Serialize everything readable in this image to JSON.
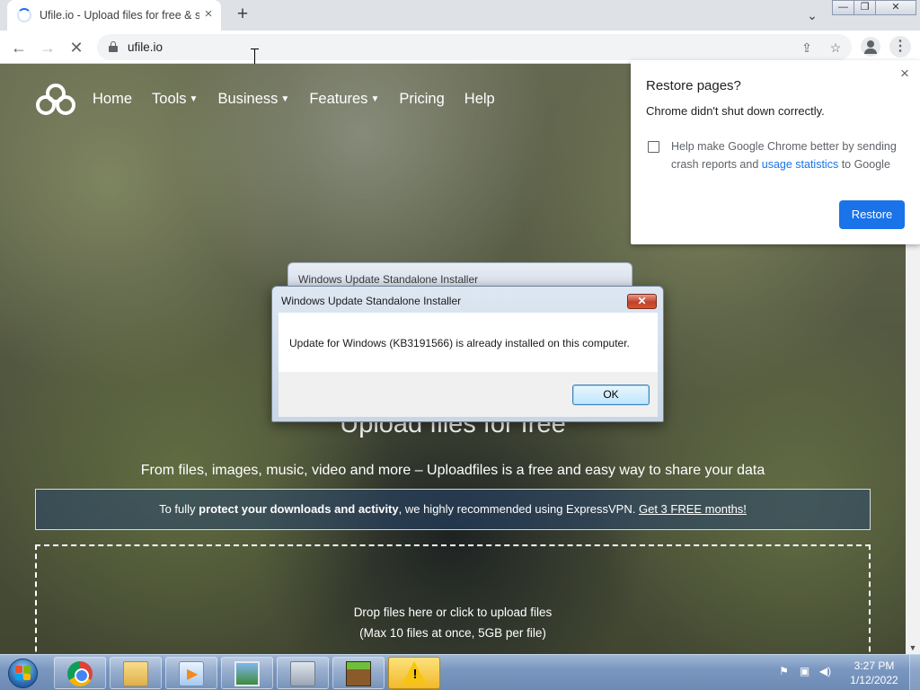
{
  "browser": {
    "tab_title": "Ufile.io - Upload files for free & s",
    "tab_close": "×",
    "new_tab": "+",
    "url": "ufile.io",
    "icons": [
      "back-arrow-icon",
      "forward-arrow-icon",
      "reload-stop-icon",
      "lock-icon",
      "share-icon",
      "bookmark-star-icon",
      "profile-icon",
      "kebab-menu-icon",
      "tab-search-icon"
    ],
    "window_buttons": {
      "minimize": "—",
      "restore": "❐",
      "close": "✕"
    }
  },
  "site": {
    "nav": [
      {
        "label": "Home",
        "dropdown": false
      },
      {
        "label": "Tools",
        "dropdown": true
      },
      {
        "label": "Business",
        "dropdown": true
      },
      {
        "label": "Features",
        "dropdown": true
      },
      {
        "label": "Pricing",
        "dropdown": false
      },
      {
        "label": "Help",
        "dropdown": false
      }
    ],
    "hero_title": "Upload files for free",
    "hero_subtitle": "From files, images, music, video and more – Uploadfiles is a free and easy way to share your data",
    "promo": {
      "prefix": "To fully ",
      "bold": "protect your downloads and activity",
      "middle": ", we highly recommended using ExpressVPN. ",
      "link": "Get 3 FREE months!"
    },
    "dropzone": {
      "line1": "Drop files here or click to upload files",
      "line2": "(Max 10 files at once, 5GB per file)"
    }
  },
  "restore_bubble": {
    "title": "Restore pages?",
    "message": "Chrome didn't shut down correctly.",
    "checkbox_line1": "Help make Google Chrome better by sending",
    "checkbox_line2_prefix": "crash reports and ",
    "checkbox_link": "usage statistics",
    "checkbox_line2_suffix": " to Google",
    "checked": false,
    "button": "Restore",
    "close": "×"
  },
  "background_dialog": {
    "title": "Windows Update Standalone Installer"
  },
  "dialog": {
    "title": "Windows Update Standalone Installer",
    "message": "Update for Windows (KB3191566) is already installed on this computer.",
    "ok": "OK",
    "close": "✕"
  },
  "taskbar": {
    "apps": [
      "chrome",
      "windows-explorer",
      "media-player",
      "photo-viewer",
      "installer",
      "minecraft",
      "windows-update-warning"
    ],
    "active_app": "windows-update-warning",
    "clock_time": "3:27 PM",
    "clock_date": "1/12/2022"
  },
  "colors": {
    "chrome_blue": "#1a73e8",
    "tabstrip": "#dee1e6",
    "taskbar": "#7a97c0",
    "warning_yellow": "#f6c514"
  }
}
